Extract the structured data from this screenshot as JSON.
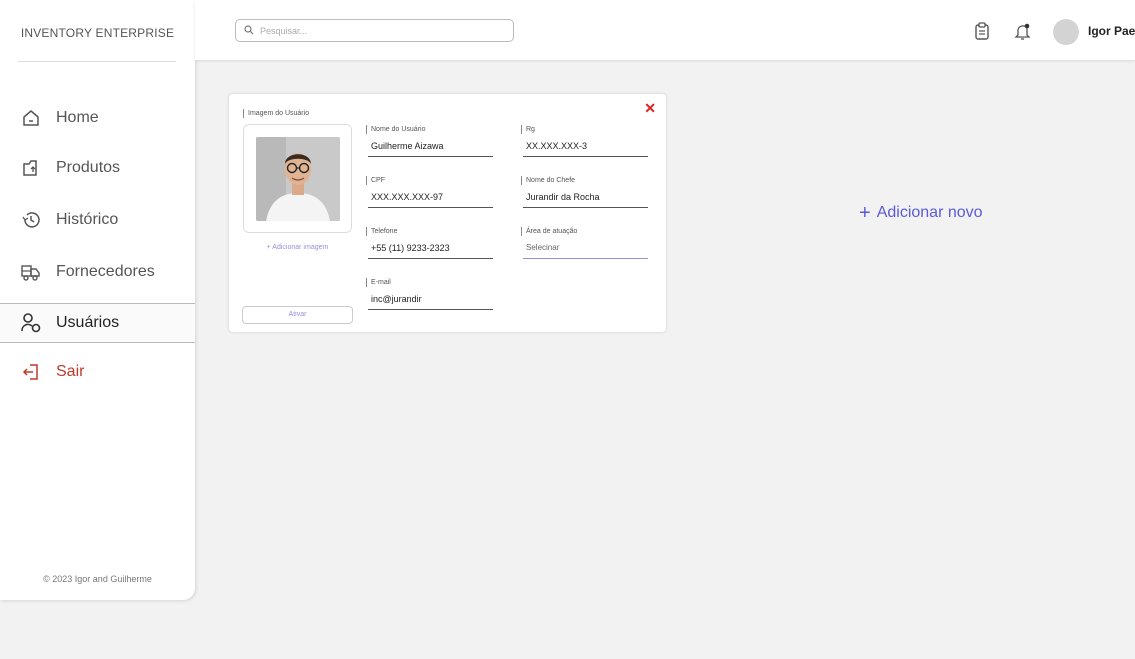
{
  "brand": "INVENTORY ENTERPRISE",
  "search": {
    "placeholder": "Pesquisar..."
  },
  "user": {
    "name": "Igor Pae"
  },
  "nav": [
    {
      "label": "Home",
      "icon": "home-icon"
    },
    {
      "label": "Produtos",
      "icon": "box-icon"
    },
    {
      "label": "Histórico",
      "icon": "history-icon"
    },
    {
      "label": "Fornecedores",
      "icon": "truck-icon"
    },
    {
      "label": "Usuários",
      "icon": "user-icon",
      "active": true
    },
    {
      "label": "Sair",
      "icon": "logout-icon"
    }
  ],
  "footer": "© 2023 Igor and Guilherme",
  "card": {
    "image_label": "Imagem do Usuário",
    "add_image": "+ Adicionar imagem",
    "activate": "Ativar",
    "close": "✕",
    "fields": {
      "name": {
        "label": "Nome do Usuário",
        "value": "Guilherme Aizawa"
      },
      "rg": {
        "label": "Rg",
        "value": "XX.XXX.XXX-3"
      },
      "cpf": {
        "label": "CPF",
        "value": "XXX.XXX.XXX-97"
      },
      "boss": {
        "label": "Nome do Chefe",
        "value": "Jurandir da Rocha"
      },
      "phone": {
        "label": "Telefone",
        "value": "+55 (11) 9233-2323"
      },
      "area": {
        "label": "Área de atuação",
        "value": "Selecinar"
      },
      "email": {
        "label": "E-mail",
        "value": "inc@jurandir"
      }
    }
  },
  "add_new": "Adicionar novo",
  "colors": {
    "accent": "#5b5bd6",
    "danger": "#e02020",
    "exit": "#c0392b"
  }
}
